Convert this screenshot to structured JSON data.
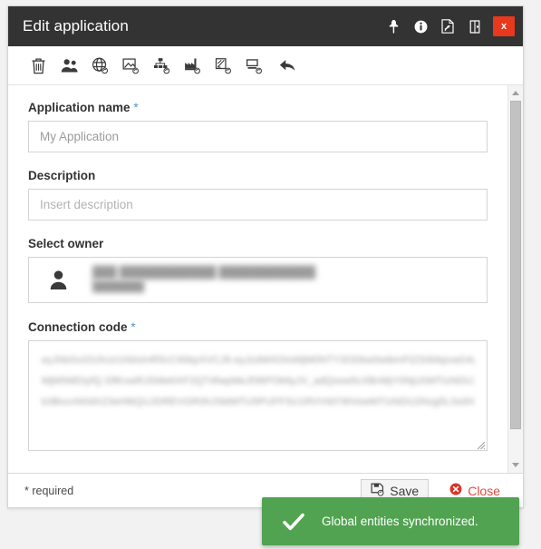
{
  "window": {
    "title": "Edit application",
    "controls": [
      {
        "name": "pin-icon",
        "label": "Pin"
      },
      {
        "name": "info-icon",
        "label": "Info"
      },
      {
        "name": "pdf-icon",
        "label": "Export PDF"
      },
      {
        "name": "restore-icon",
        "label": "Restore"
      }
    ],
    "close_label": "x"
  },
  "toolbar": {
    "items": [
      {
        "name": "trash-icon",
        "label": "Delete"
      },
      {
        "name": "users-icon",
        "label": "Users"
      },
      {
        "name": "globe-icon",
        "label": "Global"
      },
      {
        "name": "image-icon",
        "label": "Image"
      },
      {
        "name": "hierarchy-icon",
        "label": "Hierarchy"
      },
      {
        "name": "factory-icon",
        "label": "Plant"
      },
      {
        "name": "edit-document-icon",
        "label": "Edit document"
      },
      {
        "name": "device-icon",
        "label": "Device"
      },
      {
        "name": "back-arrow-icon",
        "label": "Back"
      }
    ]
  },
  "form": {
    "application_name": {
      "label": "Application name",
      "required_mark": "*",
      "value": "My Application",
      "placeholder": "My Application"
    },
    "description": {
      "label": "Description",
      "value": "",
      "placeholder": "Insert description"
    },
    "owner": {
      "label": "Select owner",
      "avatar_icon": "user-icon",
      "name_line": "███ ████████████ ████████████",
      "detail_line": "███████"
    },
    "connection_code": {
      "label": "Connection code",
      "required_mark": "*",
      "lines": [
        "eyJhbGciOiJIUzI1NiIsInR5cCI6IkpXVCJ9.eyJzdWIiOiIxMjM0NTY3ODkwIiwibmFtZSI6IkpvaG4gRG9lIiwiaWF0IjoxNTE2",
        "MjM5MDIyfQ.SflKxwRJSMeKKF2QT4fwpMeJf36POk6yJV_adQssw5cXBnMjY0NjU0MTIzNDU2Nzg5MGFiY2RlZmdoaWprbG1u",
        "b3BxcnN0dXZ3eHl6QUJDREVGR0hJSktMTU5PUFFSU1RVVldYWVowMTIzNDU2Nzg5LSs9XC8uLg"
      ]
    }
  },
  "footer": {
    "required_note": "* required",
    "save_label": "Save",
    "close_label": "Close"
  },
  "toast": {
    "icon": "check-icon",
    "message": "Global entities synchronized.",
    "color": "#51a351"
  },
  "scrollbar": {
    "up_label": "scroll up",
    "down_label": "scroll down"
  }
}
